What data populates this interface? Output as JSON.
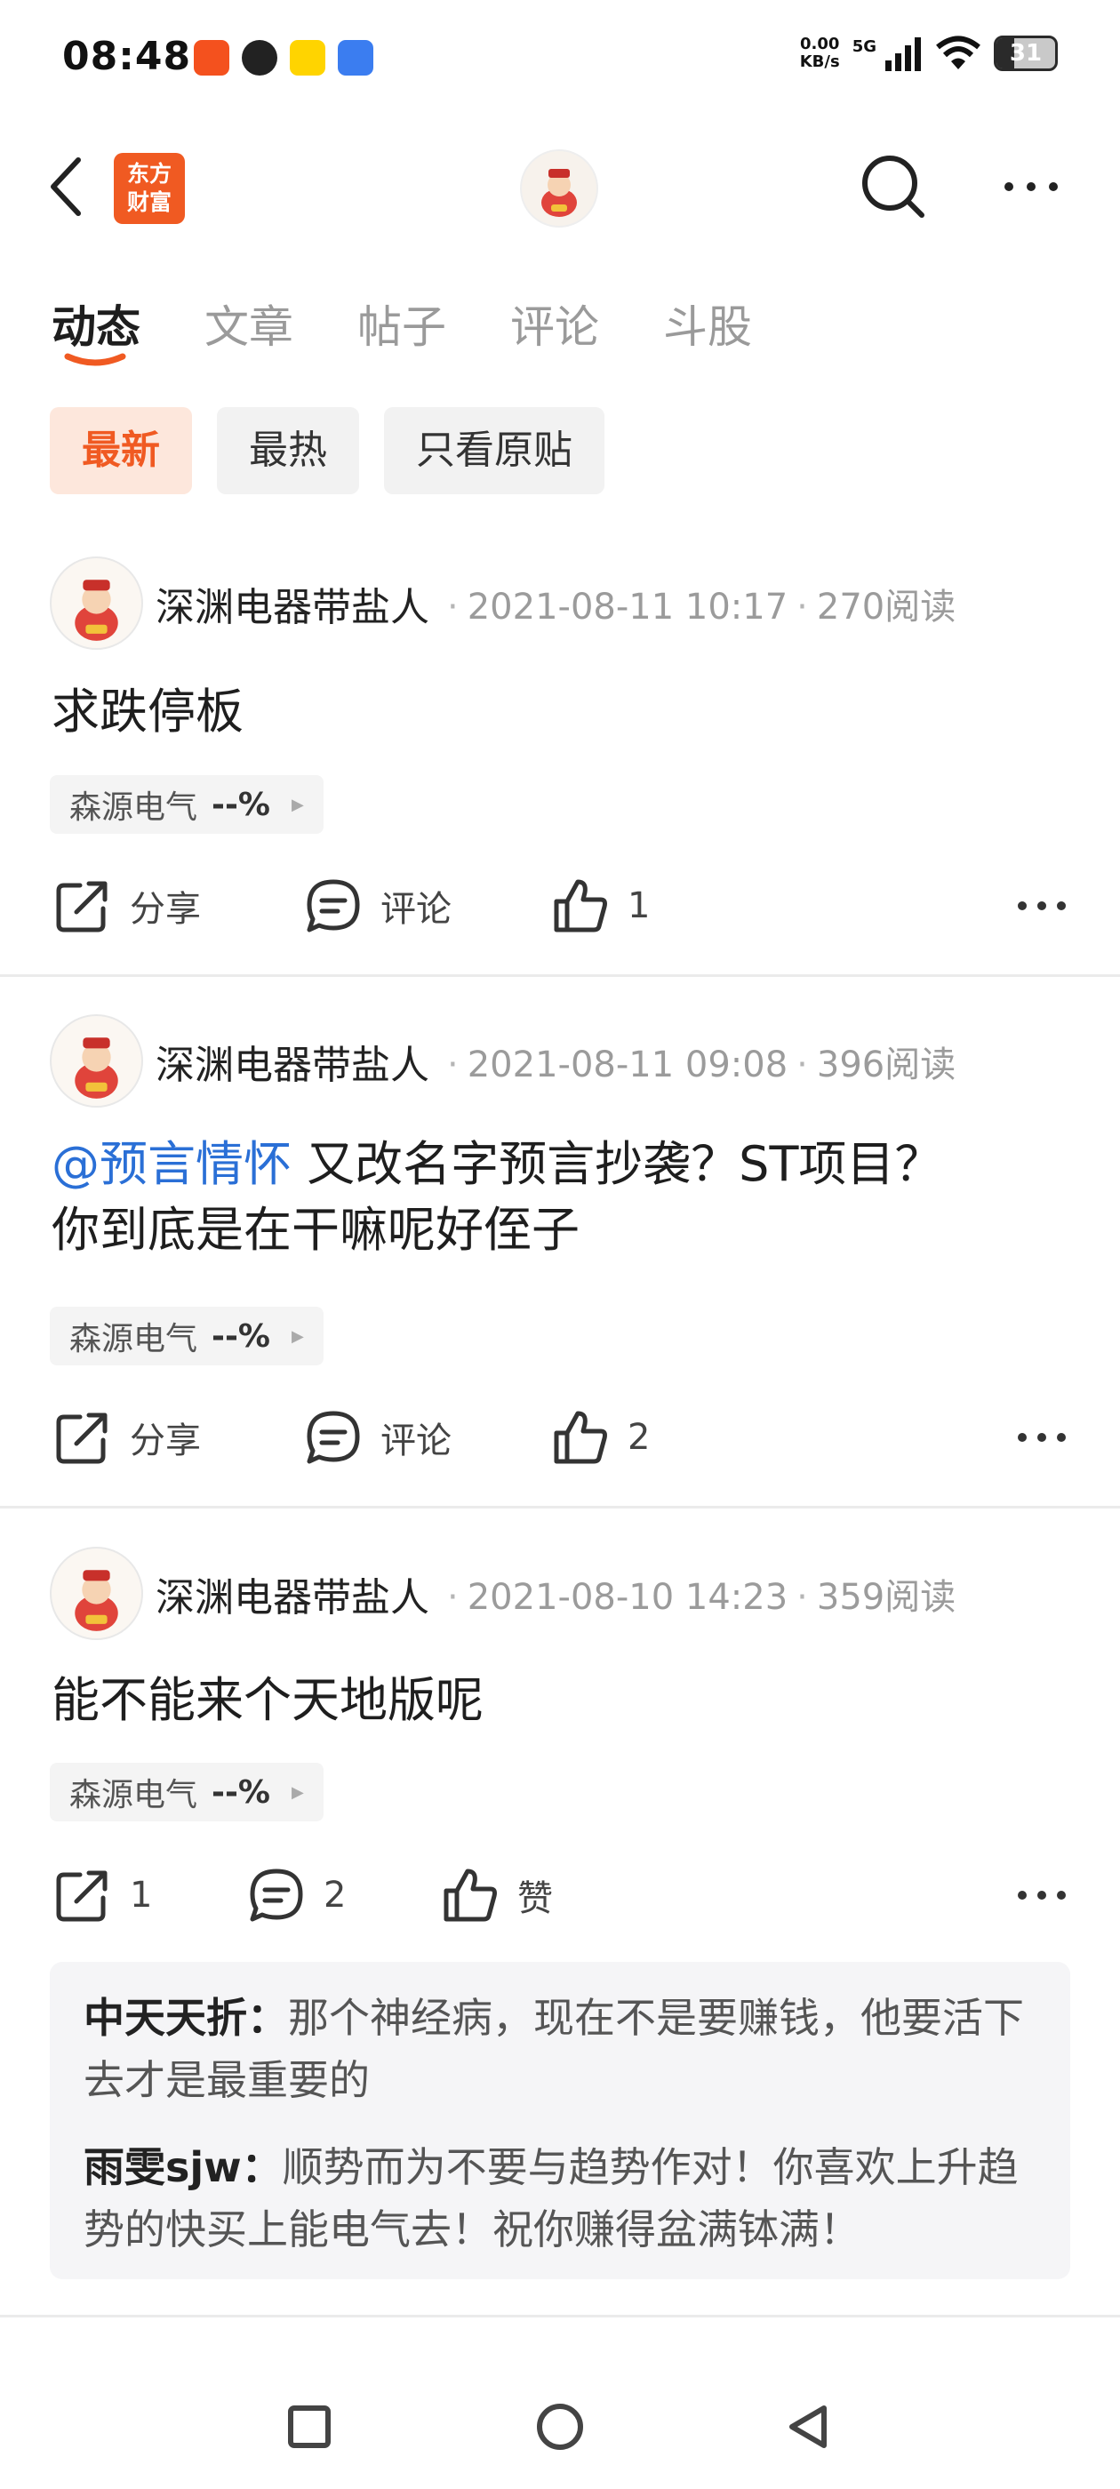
{
  "status_bar": {
    "time": "08:48",
    "net_speed_value": "0.00",
    "net_speed_unit": "KB/s",
    "network": "5G",
    "battery": "31",
    "battery_level": 0.31
  },
  "header": {
    "logo_line1": "东方",
    "logo_line2": "财富",
    "brand_color": "#f05a22"
  },
  "tabs": [
    "动态",
    "文章",
    "帖子",
    "评论",
    "斗股"
  ],
  "filters": [
    "最新",
    "最热",
    "只看原贴"
  ],
  "posts": [
    {
      "author": "深渊电器带盐人",
      "time": "2021-08-11 10:17",
      "reads": "270阅读",
      "content": "求跌停板",
      "stock_name": "森源电气",
      "stock_change": "--%",
      "share_label": "分享",
      "comment_label": "评论",
      "likes": "1"
    },
    {
      "author": "深渊电器带盐人",
      "time": "2021-08-11 09:08",
      "reads": "396阅读",
      "mention": "@预言情怀",
      "content_line1": " 又改名字预言抄袭？ST项目？",
      "content_line2": "你到底是在干嘛呢好侄子",
      "stock_name": "森源电气",
      "stock_change": "--%",
      "share_label": "分享",
      "comment_label": "评论",
      "likes": "2"
    },
    {
      "author": "深渊电器带盐人",
      "time": "2021-08-10 14:23",
      "reads": "359阅读",
      "content": "能不能来个天地版呢",
      "stock_name": "森源电气",
      "stock_change": "--%",
      "shares": "1",
      "comments": "2",
      "like_label": "赞",
      "replies": [
        {
          "user": "中天天折：",
          "text": "那个神经病，现在不是要赚钱，他要活下去才是最重要的"
        },
        {
          "user": "雨雯sjw：",
          "text": "顺势而为不要与趋势作对！你喜欢上升趋势的快买上能电气去！祝你赚得盆满钵满！"
        }
      ]
    }
  ]
}
